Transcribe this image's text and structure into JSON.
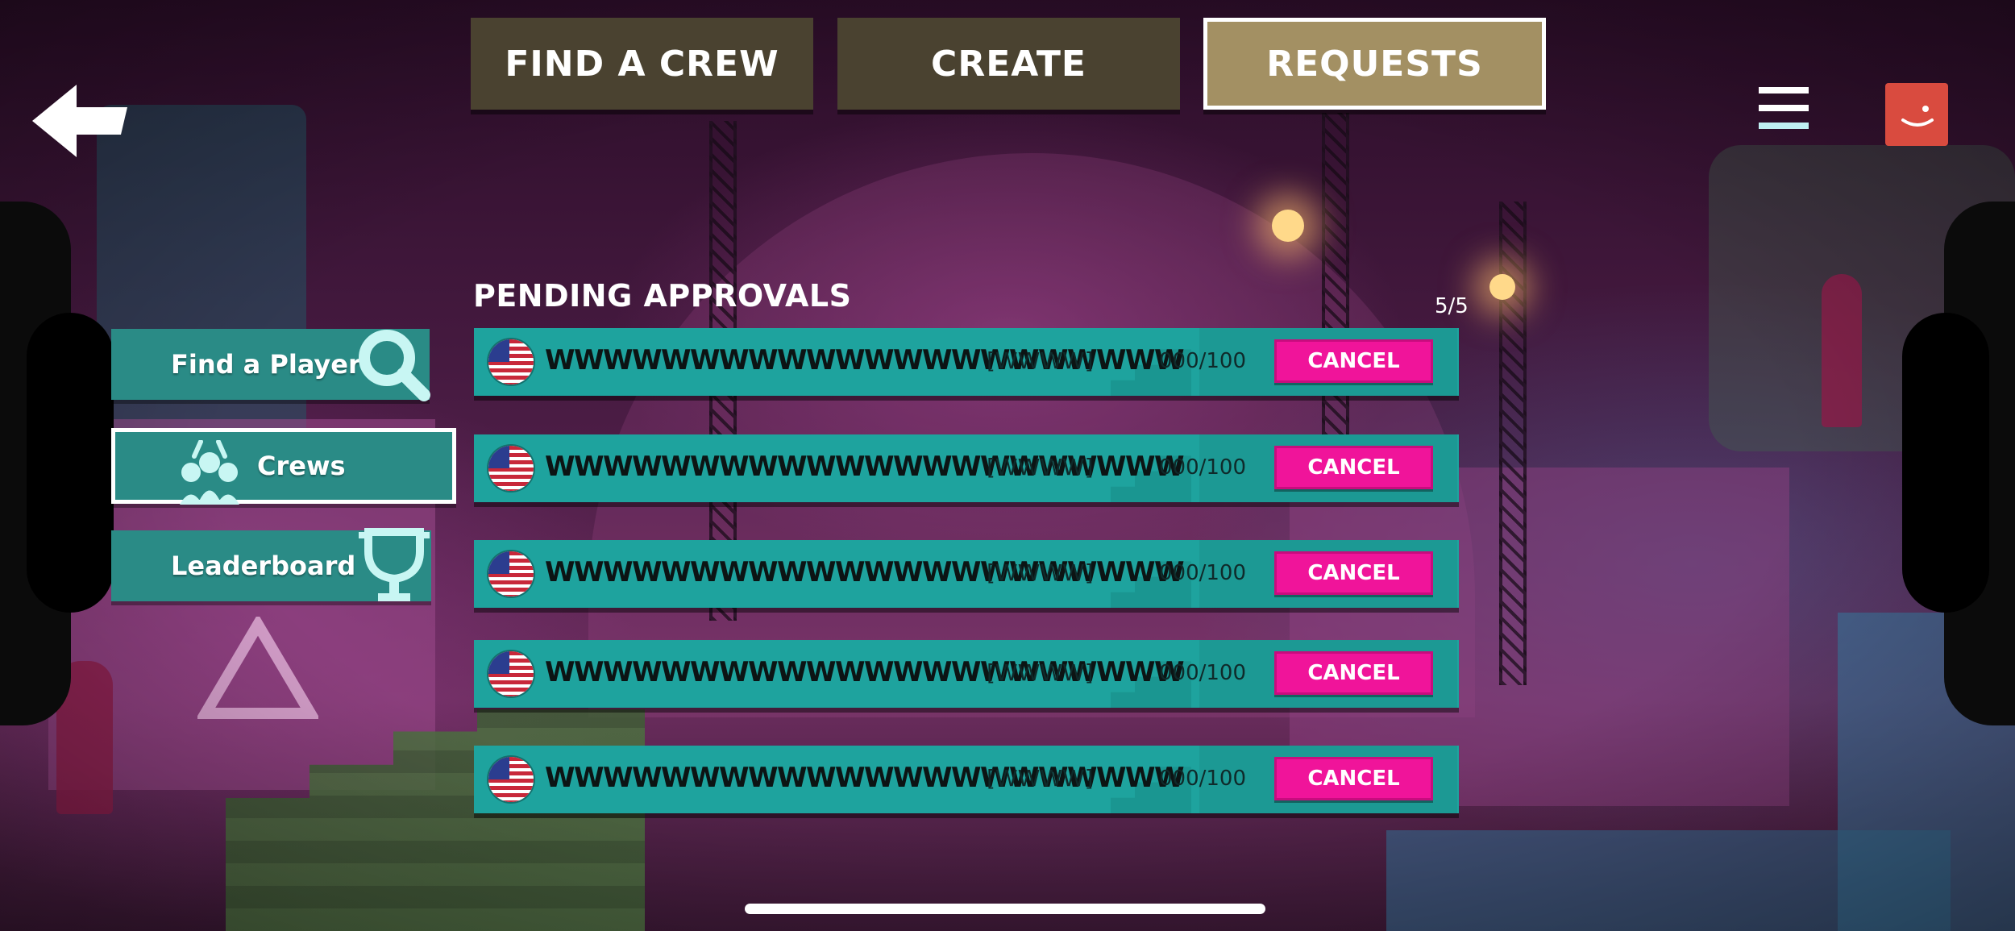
{
  "top_tabs": [
    {
      "label": "FIND A CREW",
      "active": false
    },
    {
      "label": "CREATE",
      "active": false
    },
    {
      "label": "REQUESTS",
      "active": true
    }
  ],
  "icons": {
    "back": "back-arrow-icon",
    "menu": "hamburger-menu-icon",
    "avatar": "profile-avatar-icon",
    "flag": "us-flag-icon"
  },
  "side_nav": [
    {
      "label": "Find a Player",
      "icon": "search-icon",
      "active": false
    },
    {
      "label": "Crews",
      "icon": "crew-group-icon",
      "active": true
    },
    {
      "label": "Leaderboard",
      "icon": "trophy-icon",
      "active": false
    }
  ],
  "pending": {
    "title": "PENDING APPROVALS",
    "count": "5/5",
    "rows": [
      {
        "name": "WWWWWWWWWWWWWWWWWWWWWW",
        "tag": "[WWWW]",
        "members": "000/100",
        "action": "CANCEL"
      },
      {
        "name": "WWWWWWWWWWWWWWWWWWWWWW",
        "tag": "[WWWW]",
        "members": "000/100",
        "action": "CANCEL"
      },
      {
        "name": "WWWWWWWWWWWWWWWWWWWWWW",
        "tag": "[WWWW]",
        "members": "000/100",
        "action": "CANCEL"
      },
      {
        "name": "WWWWWWWWWWWWWWWWWWWWWW",
        "tag": "[WWWW]",
        "members": "000/100",
        "action": "CANCEL"
      },
      {
        "name": "WWWWWWWWWWWWWWWWWWWWWW",
        "tag": "[WWWW]",
        "members": "000/100",
        "action": "CANCEL"
      }
    ]
  },
  "colors": {
    "tab_inactive": "#4a4230",
    "tab_active": "#a39063",
    "row_teal": "#1ea39e",
    "cancel_pink": "#f0149a",
    "side_teal": "#2a8b86",
    "avatar_red": "#d94b3f"
  }
}
